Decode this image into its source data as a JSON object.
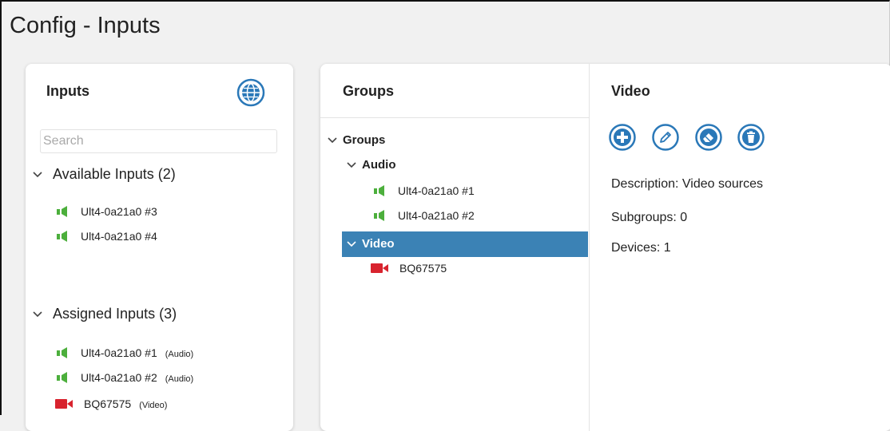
{
  "page": {
    "title": "Config - Inputs"
  },
  "inputs_panel": {
    "title": "Inputs",
    "search_placeholder": "Search",
    "available": {
      "header": "Available Inputs (2)",
      "items": [
        {
          "label": "Ult4-0a21a0 #3",
          "type": "audio"
        },
        {
          "label": "Ult4-0a21a0 #4",
          "type": "audio"
        }
      ]
    },
    "assigned": {
      "header": "Assigned Inputs (3)",
      "items": [
        {
          "label": "Ult4-0a21a0 #1",
          "tag": "(Audio)",
          "type": "audio"
        },
        {
          "label": "Ult4-0a21a0 #2",
          "tag": "(Audio)",
          "type": "audio"
        },
        {
          "label": "BQ67575",
          "tag": "(Video)",
          "type": "video"
        }
      ]
    }
  },
  "groups_panel": {
    "title": "Groups",
    "tree": {
      "root": "Groups",
      "audio": {
        "label": "Audio",
        "items": [
          "Ult4-0a21a0 #1",
          "Ult4-0a21a0 #2"
        ]
      },
      "video": {
        "label": "Video",
        "items": [
          "BQ67575"
        ]
      }
    }
  },
  "detail_panel": {
    "title": "Video",
    "description": "Description: Video sources",
    "subgroups": "Subgroups: 0",
    "devices": "Devices: 1"
  },
  "colors": {
    "accent": "#2a78b8",
    "audio_icon": "#4caf3c",
    "video_icon": "#d8232e",
    "selected_bg": "#3b82b5"
  },
  "icons": {
    "audio": "speaker-icon",
    "video": "video-camera-icon",
    "add": "plus-circle-icon",
    "edit": "pencil-circle-icon",
    "clear": "eraser-circle-icon",
    "delete": "trash-circle-icon",
    "globe": "globe-icon"
  }
}
